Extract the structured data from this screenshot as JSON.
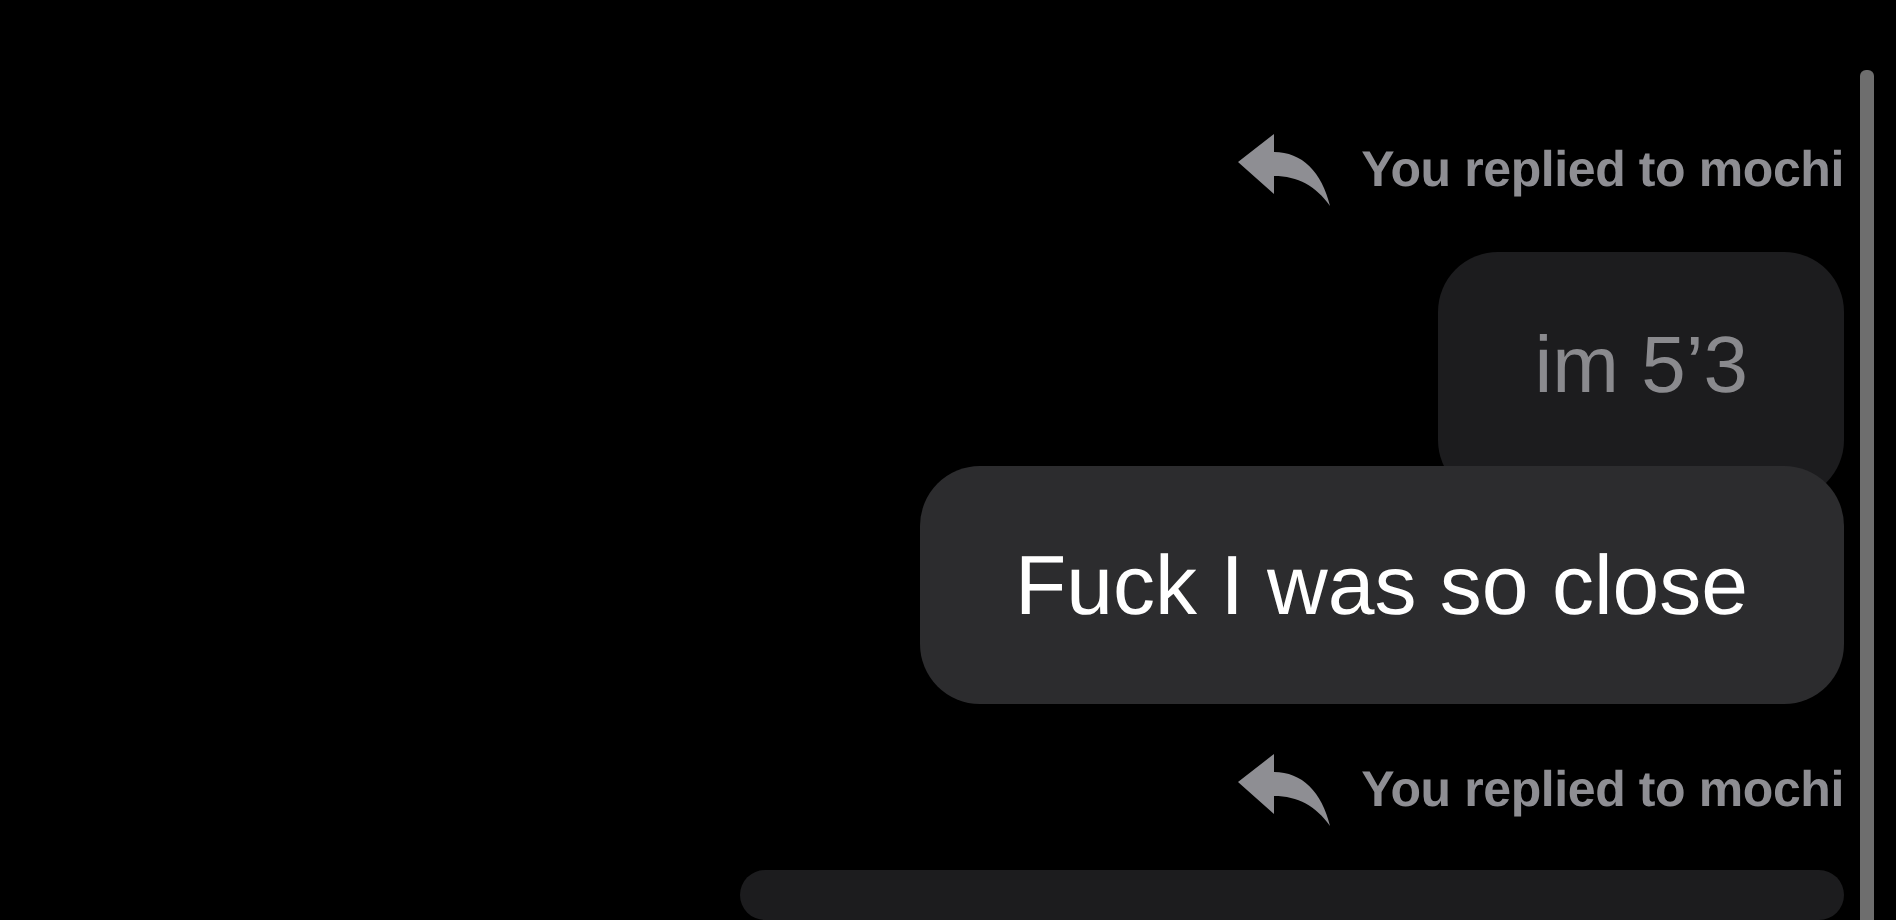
{
  "messages": [
    {
      "kind": "reply_header",
      "text": "You replied to mochi"
    },
    {
      "kind": "quoted",
      "text": "im 5’3"
    },
    {
      "kind": "message",
      "text": "Fuck I was so close"
    },
    {
      "kind": "reply_header",
      "text": "You replied to mochi"
    },
    {
      "kind": "quoted"
    }
  ]
}
